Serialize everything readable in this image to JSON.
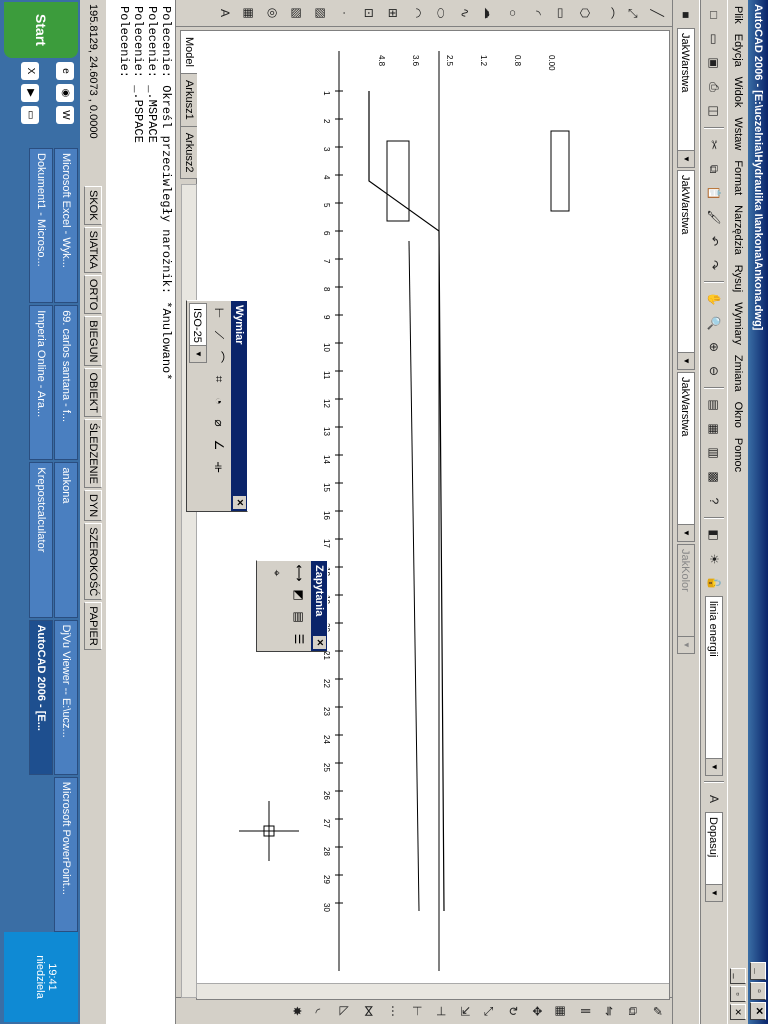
{
  "window": {
    "title": "AutoCAD 2006 - [E:\\uczelnia\\Hydraulika I\\ankona\\Ankona.dwg]",
    "controls": [
      "_",
      "▫",
      "✕"
    ]
  },
  "menu": {
    "items": [
      "Plik",
      "Edycja",
      "Widok",
      "Wstaw",
      "Format",
      "Narzędzia",
      "Rysuj",
      "Wymiary",
      "Zmiana",
      "Okno",
      "Pomoc"
    ]
  },
  "layer_toolbar": {
    "layer_name": "linia energii",
    "style_combo": "Dopasuj"
  },
  "properties_toolbar": {
    "layer_combo": "JakWarstwa",
    "linetype_combo": "JakWarstwa",
    "lineweight_combo": "JakWarstwa",
    "plotstyle_combo": "JakKolor"
  },
  "layout_tabs": {
    "tabs": [
      "Model",
      "Arkusz1",
      "Arkusz2"
    ],
    "active": "Model"
  },
  "dimension_panel": {
    "title": "Wymiar",
    "style_combo": "ISO-25"
  },
  "inquiry_panel": {
    "title": "Zapytania"
  },
  "drawing": {
    "station_labels": [
      "1",
      "2",
      "3",
      "4",
      "5",
      "6",
      "7",
      "8",
      "9",
      "10",
      "11",
      "12",
      "13",
      "14",
      "15",
      "16",
      "17",
      "18",
      "19",
      "20",
      "21",
      "22",
      "23",
      "24",
      "25",
      "26",
      "27",
      "28",
      "29",
      "30"
    ],
    "dimension_values": [
      "0.00",
      "0.8",
      "1.2",
      "2.5",
      "3.6",
      "4.8"
    ]
  },
  "command_line": {
    "lines": [
      "Polecenie: Określ przeciwległy narożnik: *Anulowano*",
      "Polecenie: _.MSPACE",
      "Polecenie: _.PSPACE",
      "Polecenie:"
    ]
  },
  "status_bar": {
    "coordinates": "195.8129, 24.6073 , 0.0000",
    "toggles": [
      "SKOK",
      "SIATKA",
      "ORTO",
      "BIEGUN",
      "OBIEKT",
      "ŚLEDZENIE",
      "DYN",
      "SZEROKOŚĆ",
      "PAPIER"
    ]
  },
  "taskbar": {
    "start_label": "Start",
    "tasks": [
      "Microsoft Excel - Wyk...",
      "69. carlos santana - f...",
      "ankona",
      "DjVu Viewer -- E:\\ucz...",
      "Microsoft PowerPoint...",
      "Dokument1 - Microso...",
      "Imperia Online - Ara...",
      "Krepostcalculator",
      "AutoCAD 2006 - [E..."
    ],
    "active_task": "AutoCAD 2006 - [E...",
    "clock_time": "19:41",
    "clock_day": "niedziela"
  },
  "colors": {
    "titlebar": "#0a246a",
    "face": "#d4d0c8",
    "taskbar": "#3a6ea5",
    "start": "#3c9c3c"
  }
}
